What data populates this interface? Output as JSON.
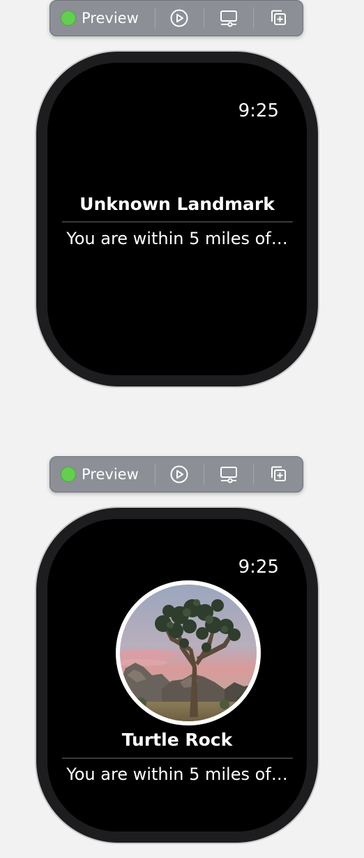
{
  "previews": [
    {
      "toolbar": {
        "preview_label": "Preview",
        "status_color": "#62cf4f",
        "buttons": [
          "play-icon",
          "device-settings-icon",
          "duplicate-icon"
        ]
      },
      "watch": {
        "time": "9:25",
        "title": "Unknown Landmark",
        "subtitle": "You are within 5 miles of…",
        "has_image": false
      }
    },
    {
      "toolbar": {
        "preview_label": "Preview",
        "status_color": "#62cf4f",
        "buttons": [
          "play-icon",
          "device-settings-icon",
          "duplicate-icon"
        ]
      },
      "watch": {
        "time": "9:25",
        "title": "Turtle Rock",
        "subtitle": "You are within 5 miles of…",
        "has_image": true,
        "image": "joshua-tree-photo"
      }
    }
  ]
}
